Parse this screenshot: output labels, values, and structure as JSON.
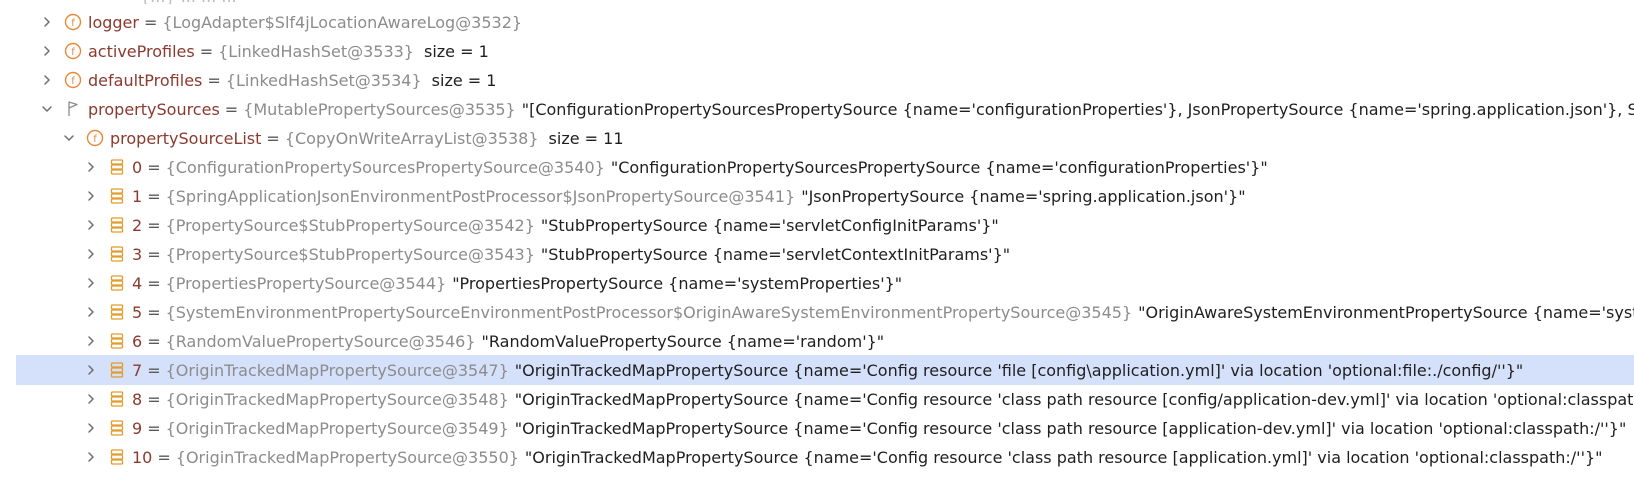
{
  "top_partial": "{...}  ...  ...  ...",
  "rows": [
    {
      "icon": "field-icon",
      "expanded": false,
      "name": "logger",
      "ref": "{LogAdapter$Slf4jLocationAwareLog@3532}",
      "value": "",
      "size": ""
    },
    {
      "icon": "field-icon",
      "expanded": false,
      "name": "activeProfiles",
      "ref": "{LinkedHashSet@3533}",
      "value": "",
      "size": "size = 1"
    },
    {
      "icon": "field-icon",
      "expanded": false,
      "name": "defaultProfiles",
      "ref": "{LinkedHashSet@3534}",
      "value": "",
      "size": "size = 1"
    },
    {
      "icon": "flag-icon",
      "expanded": true,
      "name": "propertySources",
      "ref": "{MutablePropertySources@3535}",
      "value": "\"[ConfigurationPropertySourcesPropertySource {name='configurationProperties'}, JsonPropertySource {name='spring.application.json'}, StubPro...",
      "size": ""
    },
    {
      "icon": "field-icon",
      "expanded": true,
      "name": "propertySourceList",
      "ref": "{CopyOnWriteArrayList@3538}",
      "value": "",
      "size": "size = 11"
    },
    {
      "icon": "array-item-icon",
      "expanded": false,
      "name": "0",
      "ref": "{ConfigurationPropertySourcesPropertySource@3540}",
      "value": "\"ConfigurationPropertySourcesPropertySource {name='configurationProperties'}\"",
      "size": ""
    },
    {
      "icon": "array-item-icon",
      "expanded": false,
      "name": "1",
      "ref": "{SpringApplicationJsonEnvironmentPostProcessor$JsonPropertySource@3541}",
      "value": "\"JsonPropertySource {name='spring.application.json'}\"",
      "size": ""
    },
    {
      "icon": "array-item-icon",
      "expanded": false,
      "name": "2",
      "ref": "{PropertySource$StubPropertySource@3542}",
      "value": "\"StubPropertySource {name='servletConfigInitParams'}\"",
      "size": ""
    },
    {
      "icon": "array-item-icon",
      "expanded": false,
      "name": "3",
      "ref": "{PropertySource$StubPropertySource@3543}",
      "value": "\"StubPropertySource {name='servletContextInitParams'}\"",
      "size": ""
    },
    {
      "icon": "array-item-icon",
      "expanded": false,
      "name": "4",
      "ref": "{PropertiesPropertySource@3544}",
      "value": "\"PropertiesPropertySource {name='systemProperties'}\"",
      "size": ""
    },
    {
      "icon": "array-item-icon",
      "expanded": false,
      "name": "5",
      "ref": "{SystemEnvironmentPropertySourceEnvironmentPostProcessor$OriginAwareSystemEnvironmentPropertySource@3545}",
      "value": "\"OriginAwareSystemEnvironmentPropertySource {name='systemEnvi",
      "size": ""
    },
    {
      "icon": "array-item-icon",
      "expanded": false,
      "name": "6",
      "ref": "{RandomValuePropertySource@3546}",
      "value": "\"RandomValuePropertySource {name='random'}\"",
      "size": ""
    },
    {
      "icon": "array-item-icon",
      "expanded": false,
      "selected": true,
      "name": "7",
      "ref": "{OriginTrackedMapPropertySource@3547}",
      "value": "\"OriginTrackedMapPropertySource {name='Config resource 'file [config\\application.yml]' via location 'optional:file:./config/''}\"",
      "size": ""
    },
    {
      "icon": "array-item-icon",
      "expanded": false,
      "name": "8",
      "ref": "{OriginTrackedMapPropertySource@3548}",
      "value": "\"OriginTrackedMapPropertySource {name='Config resource 'class path resource [config/application-dev.yml]' via location 'optional:classpath:/conf",
      "size": ""
    },
    {
      "icon": "array-item-icon",
      "expanded": false,
      "name": "9",
      "ref": "{OriginTrackedMapPropertySource@3549}",
      "value": "\"OriginTrackedMapPropertySource {name='Config resource 'class path resource [application-dev.yml]' via location 'optional:classpath:/''}\"",
      "size": ""
    },
    {
      "icon": "array-item-icon",
      "expanded": false,
      "name": "10",
      "ref": "{OriginTrackedMapPropertySource@3550}",
      "value": "\"OriginTrackedMapPropertySource {name='Config resource 'class path resource [application.yml]' via location 'optional:classpath:/''}\"",
      "size": ""
    }
  ],
  "colors": {
    "selection": "#d5e1fb",
    "field_icon": "#e8893a",
    "array_icon": "#e39b2a",
    "name": "#8a3a2e",
    "ref": "#8c8c8c"
  }
}
